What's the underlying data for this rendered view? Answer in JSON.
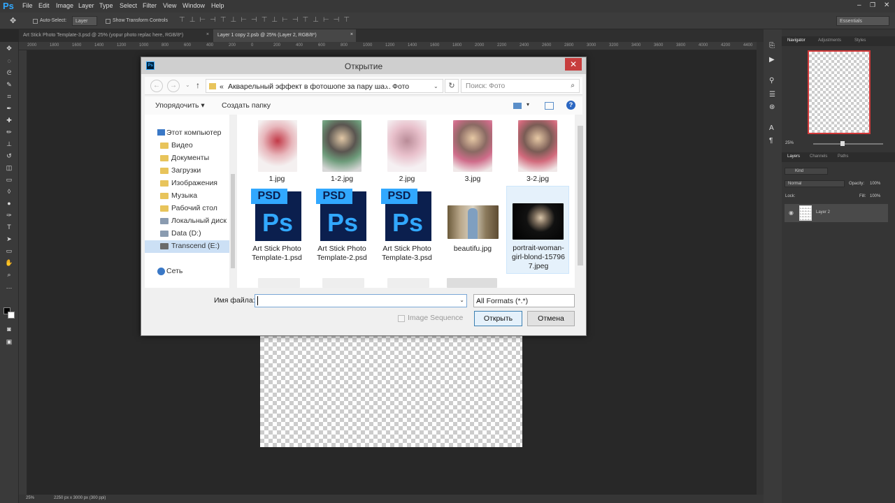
{
  "app": {
    "logo": "Ps",
    "menu": [
      "File",
      "Edit",
      "Image",
      "Layer",
      "Type",
      "Select",
      "Filter",
      "View",
      "Window",
      "Help"
    ],
    "workspace": "Essentials"
  },
  "options": {
    "auto_select": "Auto-Select:",
    "layer_value": "Layer",
    "show_transform": "Show Transform Controls"
  },
  "tabs": [
    {
      "label": "Art Stick Photo Template-3.psd @ 25% (yopur photo replac here, RGB/8*)",
      "close": "×"
    },
    {
      "label": "Layer 1 copy 2.psb @ 25% (Layer 2, RGB/8*)",
      "close": "×"
    }
  ],
  "ruler": [
    "2000",
    "1800",
    "1600",
    "1400",
    "1200",
    "1000",
    "800",
    "600",
    "400",
    "200",
    "0",
    "200",
    "400",
    "600",
    "800",
    "1000",
    "1200",
    "1400",
    "1600",
    "1800",
    "2000",
    "2200",
    "2400",
    "2600",
    "2800",
    "3000",
    "3200",
    "3400",
    "3600",
    "3800",
    "4000",
    "4200",
    "4400"
  ],
  "status": {
    "zoom": "25%",
    "doc": "2250 px x 3000 px (300 ppi)"
  },
  "panels": {
    "top_tabs": [
      "Navigator",
      "Adjustments",
      "Styles"
    ],
    "nav_zoom": "25%",
    "layer_tabs": [
      "Layers",
      "Channels",
      "Paths"
    ],
    "kind": "Kind",
    "blend": "Normal",
    "opacity_label": "Opacity:",
    "opacity": "100%",
    "lock_label": "Lock:",
    "fill_label": "Fill:",
    "fill": "100%",
    "layer_name": "Layer 2"
  },
  "dialog": {
    "title": "Открытие",
    "close": "✕",
    "breadcrumb_prefix": "«",
    "breadcrumb_1": "Акварельный эффект в фотошопе за пару ша...",
    "breadcrumb_sep": "›",
    "breadcrumb_2": "Фото",
    "search_placeholder": "Поиск: Фото",
    "organize": "Упорядочить",
    "new_folder": "Создать папку",
    "sidebar": [
      {
        "label": "Этот компьютер",
        "icon": "computer-icon"
      },
      {
        "label": "Видео",
        "icon": "folder-icon"
      },
      {
        "label": "Документы",
        "icon": "folder-icon"
      },
      {
        "label": "Загрузки",
        "icon": "folder-icon"
      },
      {
        "label": "Изображения",
        "icon": "folder-icon"
      },
      {
        "label": "Музыка",
        "icon": "folder-icon"
      },
      {
        "label": "Рабочий стол",
        "icon": "folder-icon"
      },
      {
        "label": "Локальный диск",
        "icon": "drive-icon"
      },
      {
        "label": "Data (D:)",
        "icon": "drive-icon"
      },
      {
        "label": "Transcend (E:)",
        "icon": "usb-drive-icon"
      },
      {
        "label": "Сеть",
        "icon": "network-icon"
      }
    ],
    "files": [
      {
        "name": "1.jpg"
      },
      {
        "name": "1-2.jpg"
      },
      {
        "name": "2.jpg"
      },
      {
        "name": "3.jpg"
      },
      {
        "name": "3-2.jpg"
      },
      {
        "name": "Art Stick Photo Template-1.psd",
        "line1": "Art Stick Photo",
        "line2": "Template-1.psd"
      },
      {
        "name": "Art Stick Photo Template-2.psd",
        "line1": "Art Stick Photo",
        "line2": "Template-2.psd"
      },
      {
        "name": "Art Stick Photo Template-3.psd",
        "line1": "Art Stick Photo",
        "line2": "Template-3.psd"
      },
      {
        "name": "beautifu.jpg"
      },
      {
        "name": "portrait-woman-girl-blond-157967.jpeg",
        "line1": "portrait-woman-",
        "line2": "girl-blond-15796",
        "line3": "7.jpeg"
      }
    ],
    "psd_tag": "PSD",
    "psd_letters": "Ps",
    "filename_label": "Имя файла:",
    "filename_value": "",
    "format": "All Formats (*.*)",
    "image_sequence": "Image Sequence",
    "open": "Открыть",
    "cancel": "Отмена"
  }
}
